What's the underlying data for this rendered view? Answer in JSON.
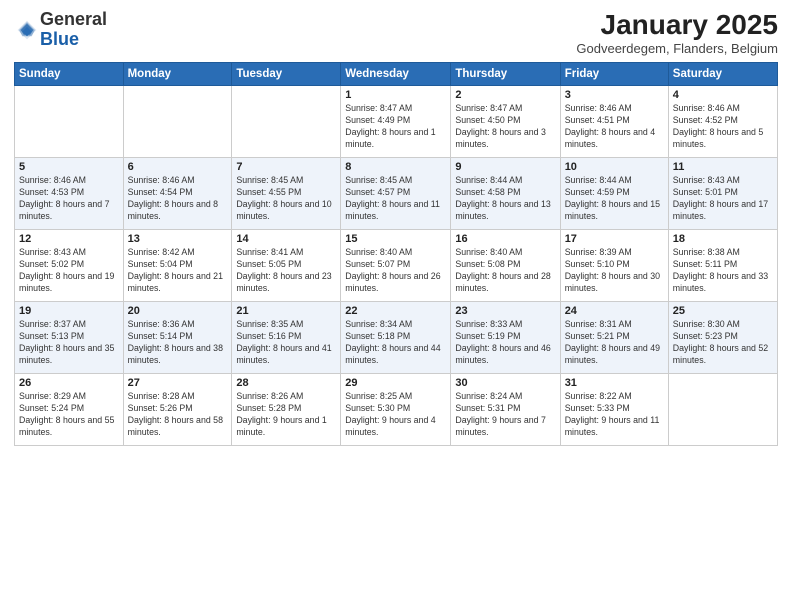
{
  "header": {
    "logo_line1": "General",
    "logo_line2": "Blue",
    "month": "January 2025",
    "location": "Godveerdegem, Flanders, Belgium"
  },
  "weekdays": [
    "Sunday",
    "Monday",
    "Tuesday",
    "Wednesday",
    "Thursday",
    "Friday",
    "Saturday"
  ],
  "weeks": [
    [
      {
        "day": "",
        "info": ""
      },
      {
        "day": "",
        "info": ""
      },
      {
        "day": "",
        "info": ""
      },
      {
        "day": "1",
        "info": "Sunrise: 8:47 AM\nSunset: 4:49 PM\nDaylight: 8 hours and 1 minute."
      },
      {
        "day": "2",
        "info": "Sunrise: 8:47 AM\nSunset: 4:50 PM\nDaylight: 8 hours and 3 minutes."
      },
      {
        "day": "3",
        "info": "Sunrise: 8:46 AM\nSunset: 4:51 PM\nDaylight: 8 hours and 4 minutes."
      },
      {
        "day": "4",
        "info": "Sunrise: 8:46 AM\nSunset: 4:52 PM\nDaylight: 8 hours and 5 minutes."
      }
    ],
    [
      {
        "day": "5",
        "info": "Sunrise: 8:46 AM\nSunset: 4:53 PM\nDaylight: 8 hours and 7 minutes."
      },
      {
        "day": "6",
        "info": "Sunrise: 8:46 AM\nSunset: 4:54 PM\nDaylight: 8 hours and 8 minutes."
      },
      {
        "day": "7",
        "info": "Sunrise: 8:45 AM\nSunset: 4:55 PM\nDaylight: 8 hours and 10 minutes."
      },
      {
        "day": "8",
        "info": "Sunrise: 8:45 AM\nSunset: 4:57 PM\nDaylight: 8 hours and 11 minutes."
      },
      {
        "day": "9",
        "info": "Sunrise: 8:44 AM\nSunset: 4:58 PM\nDaylight: 8 hours and 13 minutes."
      },
      {
        "day": "10",
        "info": "Sunrise: 8:44 AM\nSunset: 4:59 PM\nDaylight: 8 hours and 15 minutes."
      },
      {
        "day": "11",
        "info": "Sunrise: 8:43 AM\nSunset: 5:01 PM\nDaylight: 8 hours and 17 minutes."
      }
    ],
    [
      {
        "day": "12",
        "info": "Sunrise: 8:43 AM\nSunset: 5:02 PM\nDaylight: 8 hours and 19 minutes."
      },
      {
        "day": "13",
        "info": "Sunrise: 8:42 AM\nSunset: 5:04 PM\nDaylight: 8 hours and 21 minutes."
      },
      {
        "day": "14",
        "info": "Sunrise: 8:41 AM\nSunset: 5:05 PM\nDaylight: 8 hours and 23 minutes."
      },
      {
        "day": "15",
        "info": "Sunrise: 8:40 AM\nSunset: 5:07 PM\nDaylight: 8 hours and 26 minutes."
      },
      {
        "day": "16",
        "info": "Sunrise: 8:40 AM\nSunset: 5:08 PM\nDaylight: 8 hours and 28 minutes."
      },
      {
        "day": "17",
        "info": "Sunrise: 8:39 AM\nSunset: 5:10 PM\nDaylight: 8 hours and 30 minutes."
      },
      {
        "day": "18",
        "info": "Sunrise: 8:38 AM\nSunset: 5:11 PM\nDaylight: 8 hours and 33 minutes."
      }
    ],
    [
      {
        "day": "19",
        "info": "Sunrise: 8:37 AM\nSunset: 5:13 PM\nDaylight: 8 hours and 35 minutes."
      },
      {
        "day": "20",
        "info": "Sunrise: 8:36 AM\nSunset: 5:14 PM\nDaylight: 8 hours and 38 minutes."
      },
      {
        "day": "21",
        "info": "Sunrise: 8:35 AM\nSunset: 5:16 PM\nDaylight: 8 hours and 41 minutes."
      },
      {
        "day": "22",
        "info": "Sunrise: 8:34 AM\nSunset: 5:18 PM\nDaylight: 8 hours and 44 minutes."
      },
      {
        "day": "23",
        "info": "Sunrise: 8:33 AM\nSunset: 5:19 PM\nDaylight: 8 hours and 46 minutes."
      },
      {
        "day": "24",
        "info": "Sunrise: 8:31 AM\nSunset: 5:21 PM\nDaylight: 8 hours and 49 minutes."
      },
      {
        "day": "25",
        "info": "Sunrise: 8:30 AM\nSunset: 5:23 PM\nDaylight: 8 hours and 52 minutes."
      }
    ],
    [
      {
        "day": "26",
        "info": "Sunrise: 8:29 AM\nSunset: 5:24 PM\nDaylight: 8 hours and 55 minutes."
      },
      {
        "day": "27",
        "info": "Sunrise: 8:28 AM\nSunset: 5:26 PM\nDaylight: 8 hours and 58 minutes."
      },
      {
        "day": "28",
        "info": "Sunrise: 8:26 AM\nSunset: 5:28 PM\nDaylight: 9 hours and 1 minute."
      },
      {
        "day": "29",
        "info": "Sunrise: 8:25 AM\nSunset: 5:30 PM\nDaylight: 9 hours and 4 minutes."
      },
      {
        "day": "30",
        "info": "Sunrise: 8:24 AM\nSunset: 5:31 PM\nDaylight: 9 hours and 7 minutes."
      },
      {
        "day": "31",
        "info": "Sunrise: 8:22 AM\nSunset: 5:33 PM\nDaylight: 9 hours and 11 minutes."
      },
      {
        "day": "",
        "info": ""
      }
    ]
  ]
}
